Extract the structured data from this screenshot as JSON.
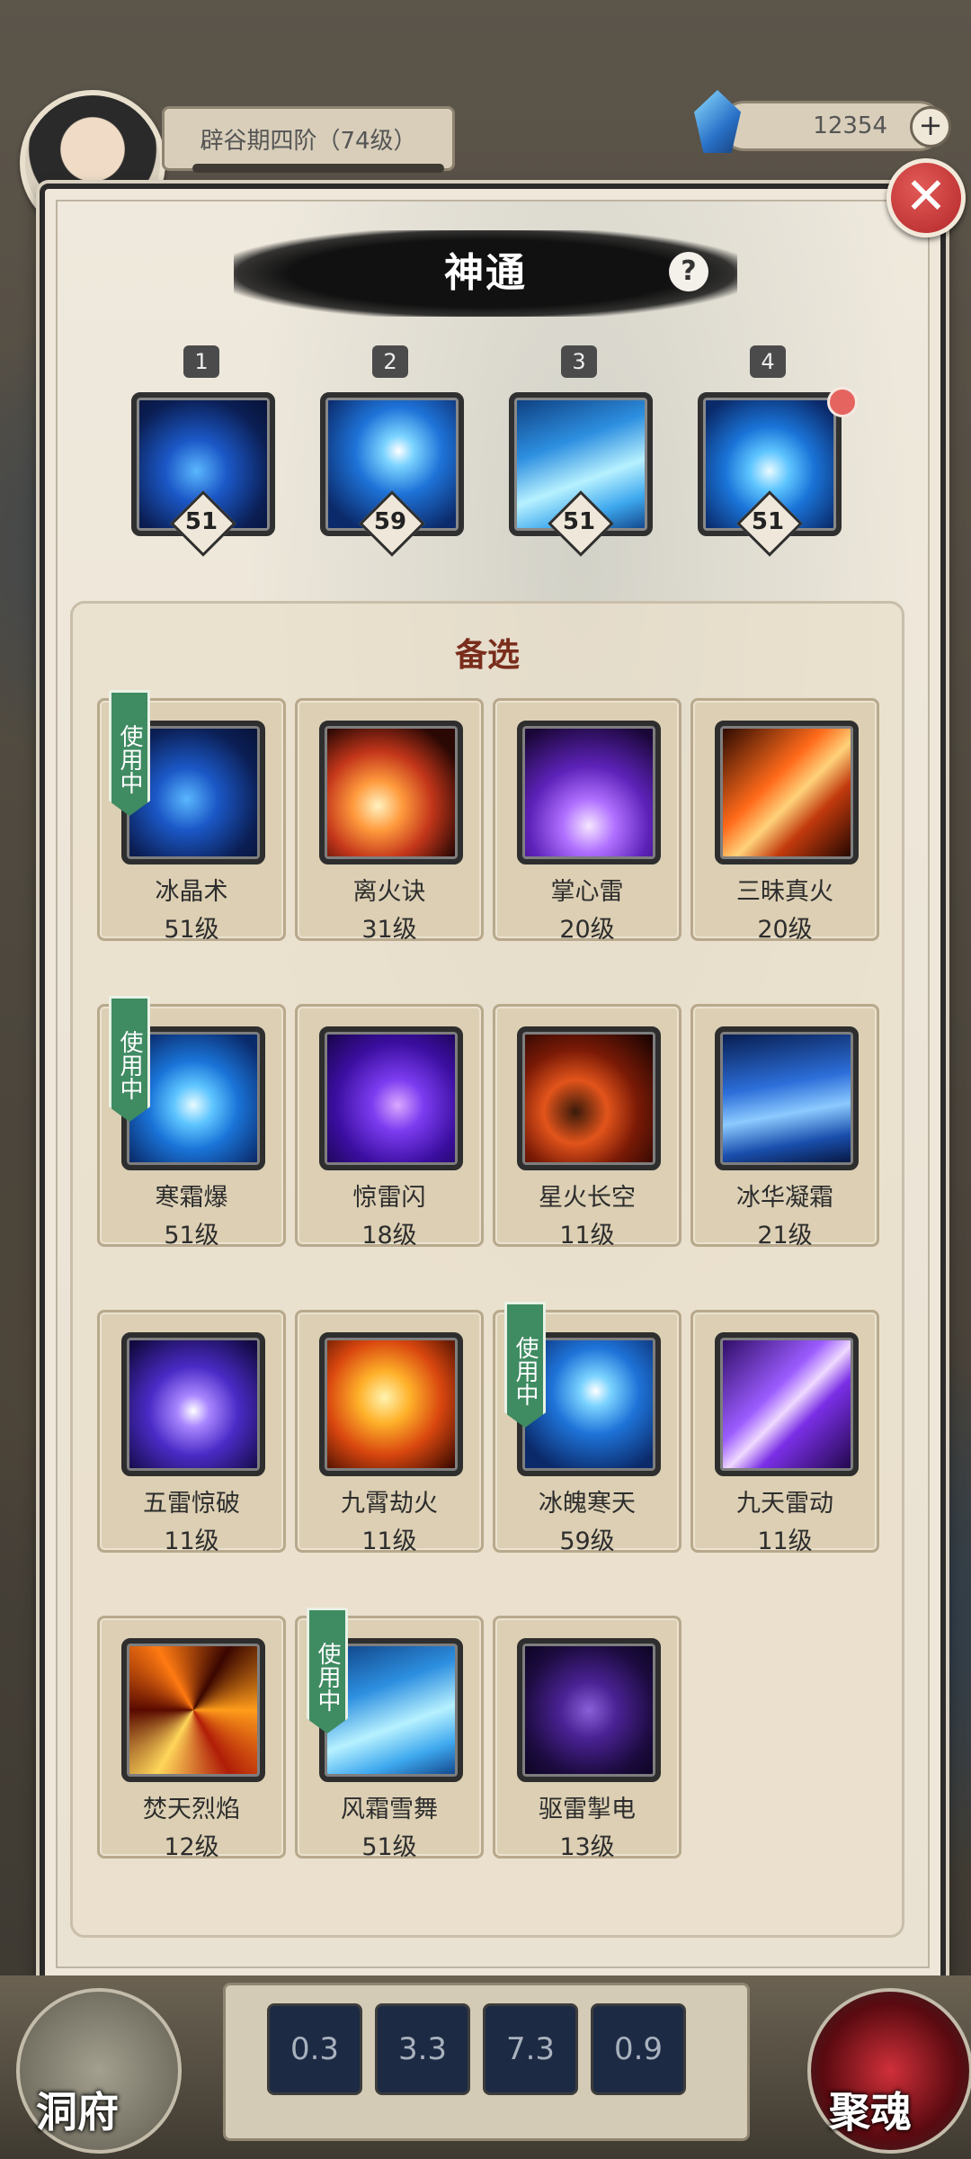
{
  "hud": {
    "rank": "辟谷期四阶（74级）",
    "currency": "12354",
    "plus": "+"
  },
  "panel": {
    "title": "神通",
    "help": "?",
    "close": "✕"
  },
  "equipped": [
    {
      "slot": "1",
      "level": "51",
      "art": "ice"
    },
    {
      "slot": "2",
      "level": "59",
      "art": "snow"
    },
    {
      "slot": "3",
      "level": "51",
      "art": "wave"
    },
    {
      "slot": "4",
      "level": "51",
      "art": "frostburst",
      "badge": true
    }
  ],
  "backup": {
    "title": "备选",
    "inuse_label": "使用中",
    "skills": [
      {
        "name": "冰晶术",
        "level": "51级",
        "inuse": true,
        "art": "ice"
      },
      {
        "name": "离火诀",
        "level": "31级",
        "inuse": false,
        "art": "fireball"
      },
      {
        "name": "掌心雷",
        "level": "20级",
        "inuse": false,
        "art": "thunder"
      },
      {
        "name": "三昧真火",
        "level": "20级",
        "inuse": false,
        "art": "flame"
      },
      {
        "name": "寒霜爆",
        "level": "51级",
        "inuse": true,
        "art": "frostburst"
      },
      {
        "name": "惊雷闪",
        "level": "18级",
        "inuse": false,
        "art": "orb"
      },
      {
        "name": "星火长空",
        "level": "11级",
        "inuse": false,
        "art": "meteor"
      },
      {
        "name": "冰华凝霜",
        "level": "21级",
        "inuse": false,
        "art": "icecrystal"
      },
      {
        "name": "五雷惊破",
        "level": "11级",
        "inuse": false,
        "art": "lightning"
      },
      {
        "name": "九霄劫火",
        "level": "11级",
        "inuse": false,
        "art": "blaze"
      },
      {
        "name": "冰魄寒天",
        "level": "59级",
        "inuse": true,
        "art": "snow"
      },
      {
        "name": "九天雷动",
        "level": "11级",
        "inuse": false,
        "art": "purplebolt"
      },
      {
        "name": "焚天烈焰",
        "level": "12级",
        "inuse": false,
        "art": "swirl"
      },
      {
        "name": "风霜雪舞",
        "level": "51级",
        "inuse": true,
        "art": "wave"
      },
      {
        "name": "驱雷掣电",
        "level": "13级",
        "inuse": false,
        "art": "cracks"
      }
    ]
  },
  "bottom": {
    "home_label": "洞府",
    "soul_label": "聚魂",
    "cooldowns": [
      "0.3",
      "3.3",
      "7.3",
      "0.9"
    ]
  }
}
